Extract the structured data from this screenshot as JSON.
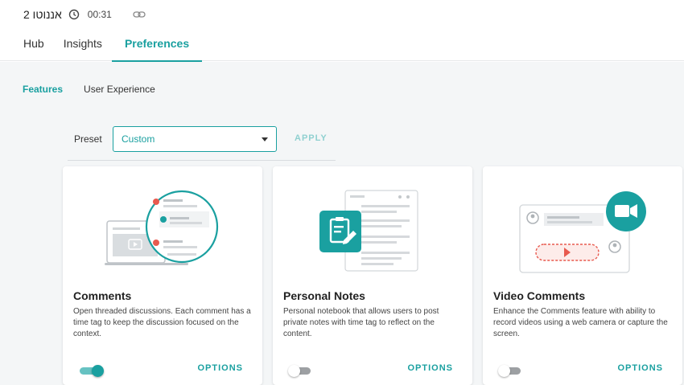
{
  "header": {
    "title": "אננוטו 2",
    "time": "00:31",
    "tabs": [
      {
        "label": "Hub"
      },
      {
        "label": "Insights"
      },
      {
        "label": "Preferences"
      }
    ]
  },
  "sub_tabs": [
    {
      "label": "Features"
    },
    {
      "label": "User Experience"
    }
  ],
  "preset": {
    "label": "Preset",
    "value": "Custom",
    "apply_label": "APPLY"
  },
  "cards": [
    {
      "title": "Comments",
      "description": "Open threaded discussions. Each comment has a time tag to keep the discussion focused on the context.",
      "options_label": "OPTIONS",
      "enabled": true
    },
    {
      "title": "Personal Notes",
      "description": "Personal notebook that allows users to post private notes with time tag to reflect on the content.",
      "options_label": "OPTIONS",
      "enabled": false
    },
    {
      "title": "Video Comments",
      "description": "Enhance the Comments feature with ability to record videos using a web camera or capture the screen.",
      "options_label": "OPTIONS",
      "enabled": false
    }
  ],
  "colors": {
    "accent": "#1aa0a0",
    "accent_light": "#66c2c2",
    "comment_red": "#e85a4f",
    "background": "#f4f6f7"
  }
}
